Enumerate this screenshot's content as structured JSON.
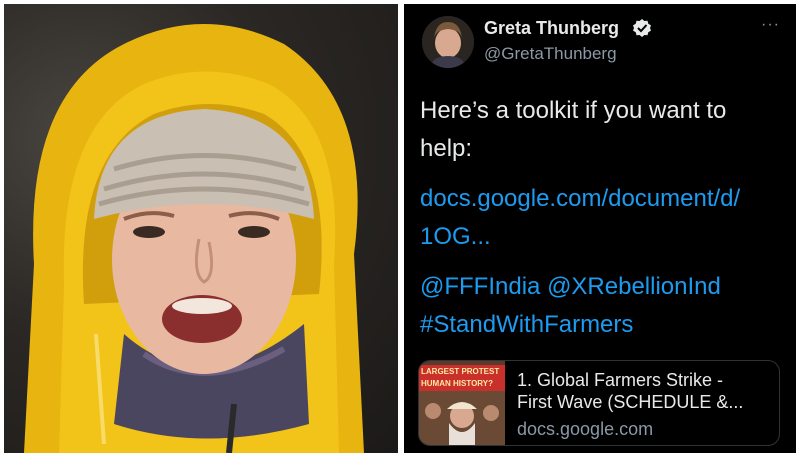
{
  "photo": {
    "subject": "greta-photo"
  },
  "tweet": {
    "author": {
      "name": "Greta Thunberg",
      "handle": "@GretaThunberg",
      "verified": true
    },
    "more_menu": "···",
    "text_lines": [
      "Here’s a toolkit if you want to",
      "help:"
    ],
    "link_lines": [
      "docs.google.com/document/d/",
      "1OG..."
    ],
    "mentions": [
      "@FFFIndia",
      "@XRebellionInd"
    ],
    "hashtag": "#StandWithFarmers",
    "card": {
      "thumb_banner": "LARGEST PROTEST HUMAN HISTORY?",
      "title_lines": [
        "1. Global Farmers Strike -",
        "First Wave (SCHEDULE &..."
      ],
      "domain": "docs.google.com"
    }
  },
  "colors": {
    "tweet_bg": "#000000",
    "text": "#e7e9ea",
    "muted": "#8b98a5",
    "link": "#1d9bf0",
    "raincoat": "#f2c318"
  }
}
